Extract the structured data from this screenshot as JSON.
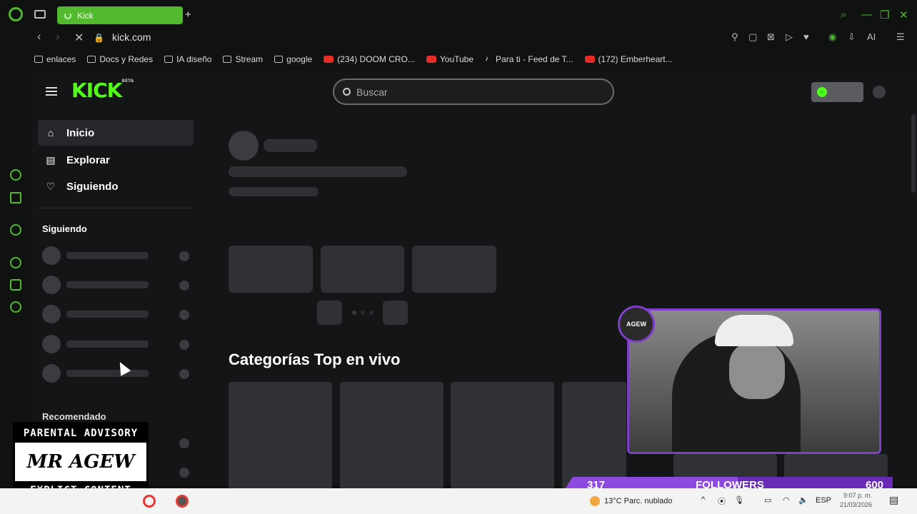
{
  "browser": {
    "tab_title": "Kick",
    "url": "kick.com",
    "bookmarks": [
      {
        "label": "enlaces",
        "icon": "folder-icon"
      },
      {
        "label": "Docs y Redes",
        "icon": "folder-icon"
      },
      {
        "label": "IA diseño",
        "icon": "folder-icon"
      },
      {
        "label": "Stream",
        "icon": "folder-icon"
      },
      {
        "label": "google",
        "icon": "folder-icon"
      },
      {
        "label": "(234) DOOM CRO...",
        "icon": "youtube-icon"
      },
      {
        "label": "YouTube",
        "icon": "youtube-icon"
      },
      {
        "label": "Para ti - Feed de T...",
        "icon": "tiktok-icon"
      },
      {
        "label": "(172) Emberheart...",
        "icon": "youtube-icon"
      }
    ],
    "toolbar_right_label": "AI",
    "accent": "#53b92f"
  },
  "kick": {
    "logo_text": "KICK",
    "logo_badge": "BETA",
    "search_placeholder": "Buscar",
    "brand_color": "#53fc18",
    "nav": [
      {
        "label": "Inicio",
        "icon": "home-icon",
        "active": true
      },
      {
        "label": "Explorar",
        "icon": "compass-icon",
        "active": false
      },
      {
        "label": "Siguiendo",
        "icon": "heart-icon",
        "active": false
      }
    ],
    "section_following": "Siguiendo",
    "section_recommended": "Recomendado",
    "categories_title": "Categorías Top en vivo"
  },
  "overlay": {
    "parental_top": "PARENTAL ADVISORY",
    "parental_mid": "MR AGEW",
    "parental_bottom": "EXPLICT CONTENT",
    "followers_current": "317",
    "followers_label": "FOLLOWERS",
    "followers_goal": "600",
    "followers_progress": 0.53,
    "cam_badge": "AGEW",
    "accent": "#7d3fc5"
  },
  "taskbar": {
    "weather": "13°C  Parc. nublado",
    "language": "ESP",
    "time": "9:07 p. m.",
    "date": "21/03/2026"
  }
}
